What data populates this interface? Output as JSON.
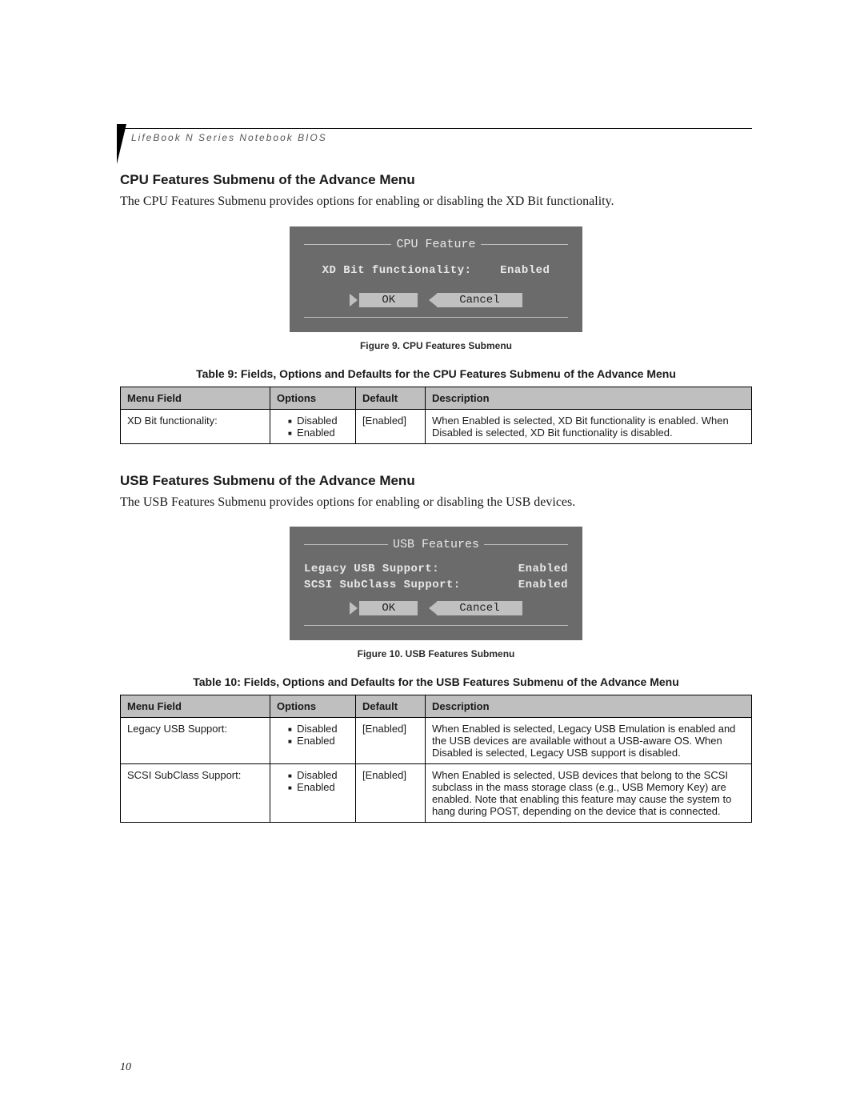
{
  "header": {
    "running_head": "LifeBook N Series Notebook BIOS"
  },
  "section1": {
    "title": "CPU Features Submenu of the Advance Menu",
    "body": "The CPU Features Submenu provides options for enabling or disabling the XD Bit functionality."
  },
  "fig9": {
    "box_title": "CPU Feature",
    "row": {
      "label": "XD Bit functionality:",
      "value": "Enabled"
    },
    "btn_ok": "OK",
    "btn_cancel": "Cancel",
    "caption": "Figure 9.  CPU Features Submenu"
  },
  "table9": {
    "caption": "Table 9: Fields, Options and Defaults for the CPU Features Submenu of the Advance Menu",
    "headers": {
      "menu": "Menu Field",
      "options": "Options",
      "def": "Default",
      "desc": "Description"
    },
    "row1": {
      "menu": "XD Bit functionality:",
      "opt1": "Disabled",
      "opt2": "Enabled",
      "def": "[Enabled]",
      "desc": "When Enabled is selected, XD Bit functionality is enabled. When Disabled is selected, XD Bit functionality is disabled."
    }
  },
  "section2": {
    "title": "USB Features Submenu of the Advance Menu",
    "body": "The USB Features Submenu provides options for enabling or disabling the USB devices."
  },
  "fig10": {
    "box_title": "USB Features",
    "row1": {
      "label": "Legacy USB Support:",
      "value": "Enabled"
    },
    "row2": {
      "label": "SCSI SubClass Support:",
      "value": "Enabled"
    },
    "btn_ok": "OK",
    "btn_cancel": "Cancel",
    "caption": "Figure 10.  USB Features Submenu"
  },
  "table10": {
    "caption": "Table 10: Fields, Options and Defaults for the USB Features Submenu of the Advance Menu",
    "headers": {
      "menu": "Menu Field",
      "options": "Options",
      "def": "Default",
      "desc": "Description"
    },
    "row1": {
      "menu": "Legacy USB Support:",
      "opt1": "Disabled",
      "opt2": "Enabled",
      "def": "[Enabled]",
      "desc": "When Enabled is selected, Legacy USB Emulation is enabled and the USB devices are available without a USB-aware OS. When Disabled is selected, Legacy USB support is disabled."
    },
    "row2": {
      "menu": "SCSI SubClass Support:",
      "opt1": "Disabled",
      "opt2": "Enabled",
      "def": "[Enabled]",
      "desc": "When Enabled is selected, USB devices that belong to the SCSI subclass in the mass storage class (e.g., USB Memory Key) are enabled. Note that enabling this feature may cause the system to hang during POST, depending on the device that is connected."
    }
  },
  "page_number": "10"
}
